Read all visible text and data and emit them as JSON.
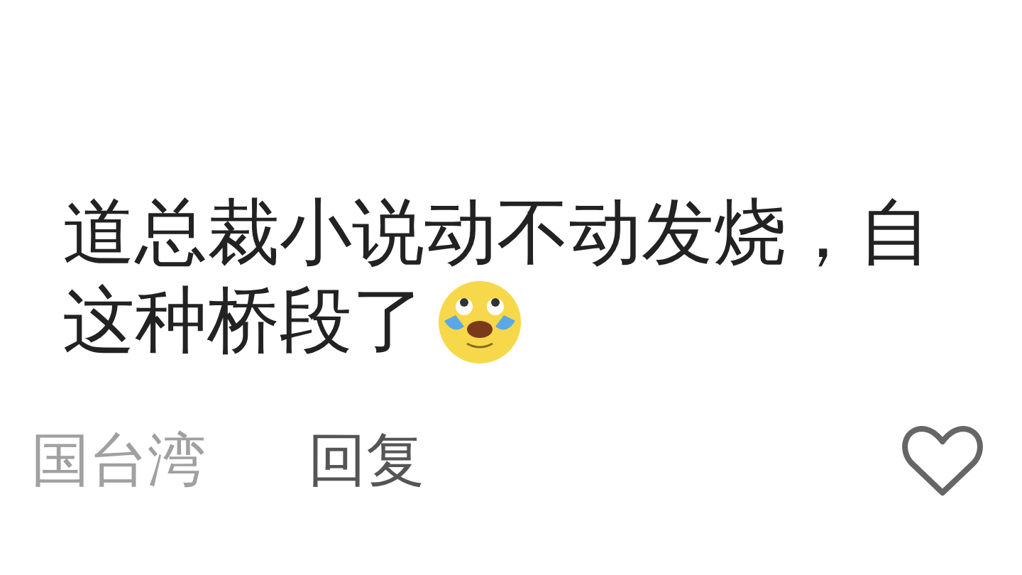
{
  "comment": {
    "lines": [
      "道总裁小说动不动发烧，自",
      "这种桥段了"
    ],
    "location": "国台湾",
    "reply": "回复",
    "liked": false
  }
}
